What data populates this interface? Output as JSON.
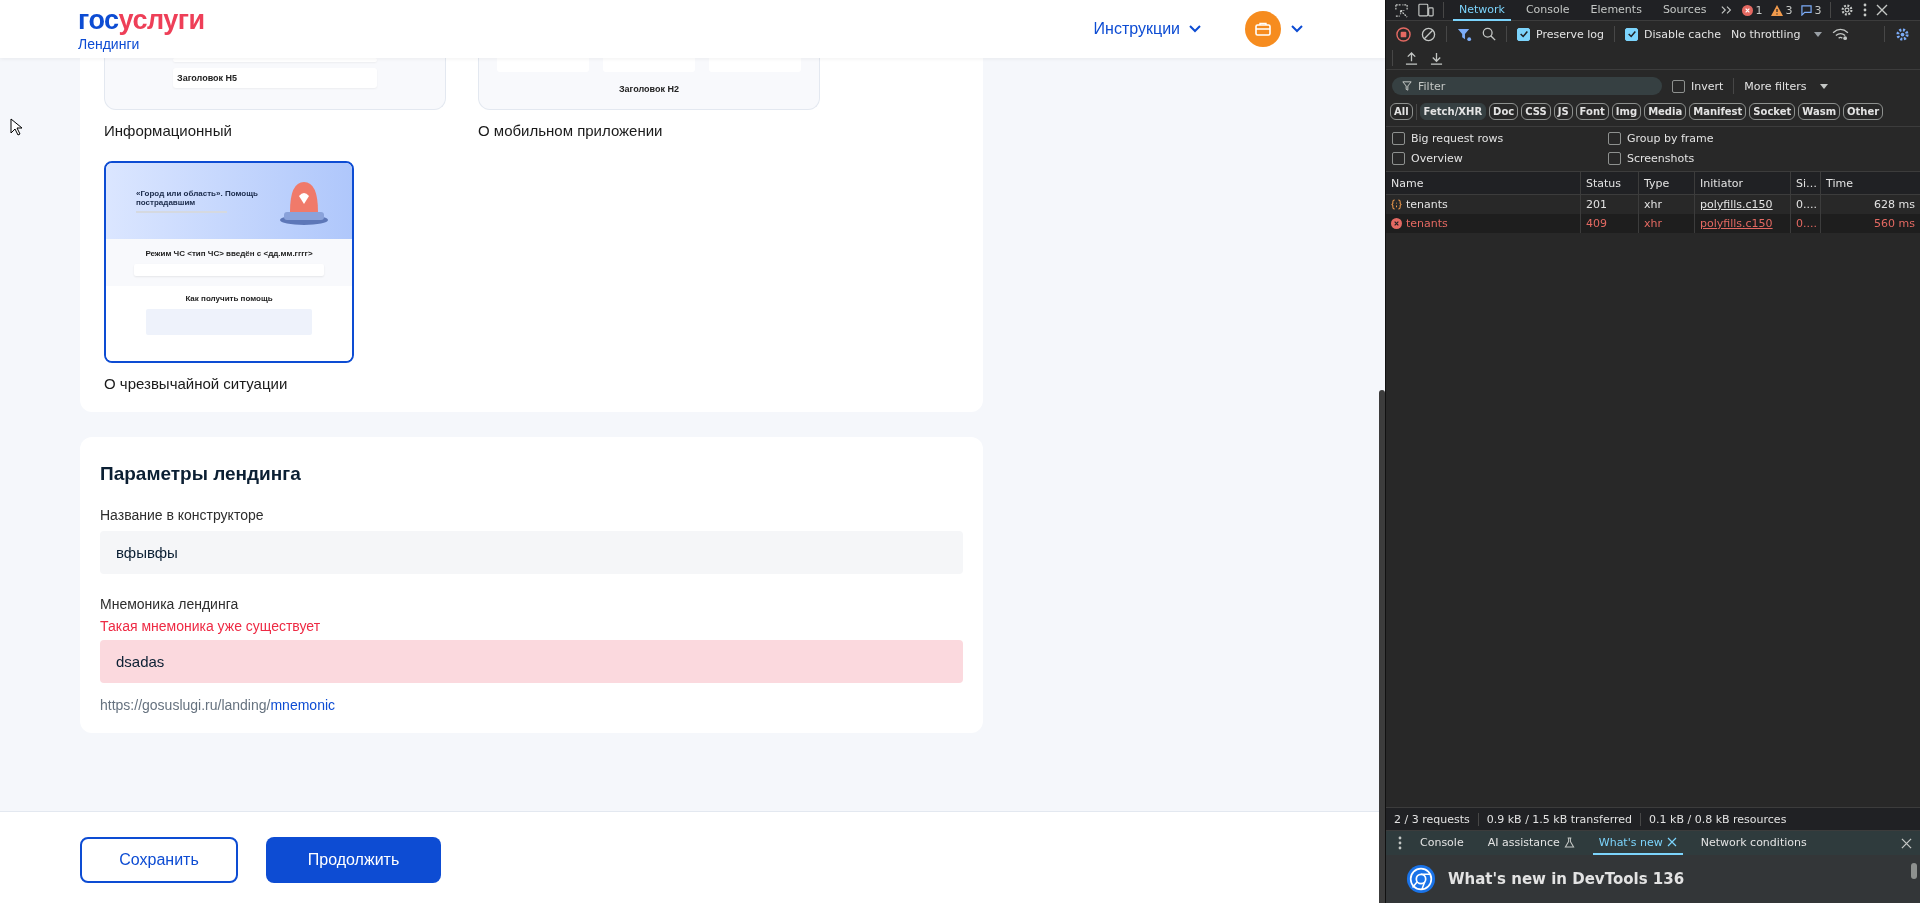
{
  "header": {
    "logo": [
      "гос",
      "услуги"
    ],
    "subtitle": "Лендинги",
    "menu": "Инструкции"
  },
  "templates": [
    {
      "label": "Информационный",
      "selected": false,
      "preview": {
        "kind": "info",
        "texts": [
          "Заголовок H5"
        ]
      }
    },
    {
      "label": "О мобильном приложении",
      "selected": false,
      "preview": {
        "kind": "mobile",
        "texts": [
          "Заголовок H2"
        ]
      }
    },
    {
      "label": "О чрезвычайной ситуации",
      "selected": true,
      "preview": {
        "kind": "emergency",
        "texts": [
          "«Город или область». Помощь пострадавшим",
          "Режим ЧС <тип ЧС> введён с <дд.мм.гггг>",
          "Как получить помощь"
        ]
      }
    }
  ],
  "form": {
    "title": "Параметры лендинга",
    "fields": [
      {
        "label": "Название в конструкторе",
        "value": "вфывфы",
        "invalid": false
      },
      {
        "label": "Мнемоника лендинга",
        "error": "Такая мнемоника уже существует",
        "value": "dsadas",
        "invalid": true
      }
    ],
    "url": {
      "prefix": "https://gosuslugi.ru/landing/",
      "link": "mnemonic"
    }
  },
  "buttons": [
    {
      "label": "Сохранить",
      "kind": "secondary"
    },
    {
      "label": "Продолжить",
      "kind": "primary"
    }
  ],
  "devtools": {
    "tabs": [
      {
        "label": "Network",
        "selected": true
      },
      {
        "label": "Console",
        "selected": false
      },
      {
        "label": "Elements",
        "selected": false
      },
      {
        "label": "Sources",
        "selected": false
      }
    ],
    "counts": {
      "errors": "1",
      "warnings": "3",
      "messages": "3"
    },
    "preserve_log": {
      "label": "Preserve log",
      "checked": true
    },
    "disable_cache": {
      "label": "Disable cache",
      "checked": true
    },
    "throttling": "No throttling",
    "filter": {
      "placeholder": "Filter"
    },
    "invert": {
      "label": "Invert",
      "checked": false
    },
    "more_filters": "More filters",
    "chips": [
      {
        "label": "All",
        "selected": false
      },
      {
        "label": "Fetch/XHR",
        "selected": true
      },
      {
        "label": "Doc",
        "selected": false
      },
      {
        "label": "CSS",
        "selected": false
      },
      {
        "label": "JS",
        "selected": false
      },
      {
        "label": "Font",
        "selected": false
      },
      {
        "label": "Img",
        "selected": false
      },
      {
        "label": "Media",
        "selected": false
      },
      {
        "label": "Manifest",
        "selected": false
      },
      {
        "label": "Socket",
        "selected": false
      },
      {
        "label": "Wasm",
        "selected": false
      },
      {
        "label": "Other",
        "selected": false
      }
    ],
    "options": [
      {
        "label": "Big request rows",
        "checked": false
      },
      {
        "label": "Group by frame",
        "checked": false
      },
      {
        "label": "Overview",
        "checked": false
      },
      {
        "label": "Screenshots",
        "checked": false
      }
    ],
    "columns": [
      "Name",
      "Status",
      "Type",
      "Initiator",
      "Si…",
      "Time"
    ],
    "rows": [
      {
        "name": "tenants",
        "status": "201",
        "type": "xhr",
        "initiator": "polyfills.c150",
        "size": "0....",
        "time": "628 ms",
        "failed": false
      },
      {
        "name": "tenants",
        "status": "409",
        "type": "xhr",
        "initiator": "polyfills.c150",
        "size": "0....",
        "time": "560 ms",
        "failed": true
      }
    ],
    "summary": [
      "2 / 3 requests",
      "0.9 kB / 1.5 kB transferred",
      "0.1 kB / 0.8 kB resources"
    ],
    "drawer_tabs": [
      {
        "label": "Console",
        "selected": false,
        "kind": "plain"
      },
      {
        "label": "AI assistance",
        "selected": false,
        "kind": "flask"
      },
      {
        "label": "What's new",
        "selected": true,
        "kind": "closable"
      },
      {
        "label": "Network conditions",
        "selected": false,
        "kind": "plain"
      }
    ],
    "whats_new": "What's new in DevTools 136"
  }
}
